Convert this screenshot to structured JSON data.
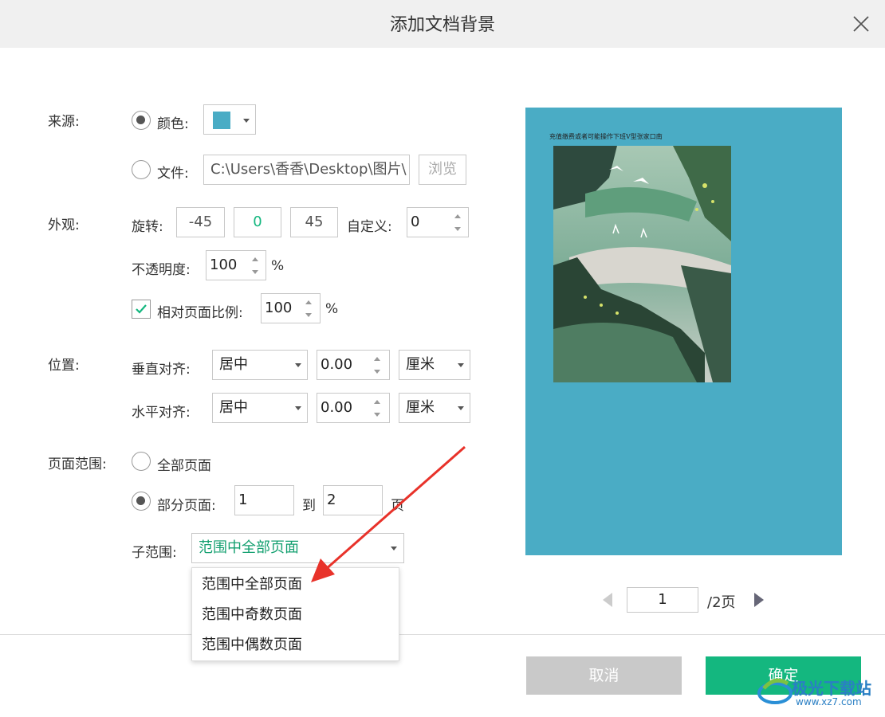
{
  "dialog": {
    "title": "添加文档背景"
  },
  "source": {
    "label": "来源:",
    "color_option": "颜色:",
    "color_value": "#4aacc5",
    "file_option": "文件:",
    "file_path": "C:\\Users\\香香\\Desktop\\图片\\",
    "browse": "浏览"
  },
  "appearance": {
    "label": "外观:",
    "rotate_label": "旋转:",
    "rotate_options": [
      "-45",
      "0",
      "45"
    ],
    "custom_label": "自定义:",
    "custom_value": "0",
    "opacity_label": "不透明度:",
    "opacity_value": "100",
    "percent": "%",
    "relative_label": "相对页面比例:",
    "relative_value": "100"
  },
  "position": {
    "label": "位置:",
    "vertical_label": "垂直对齐:",
    "vertical_align": "居中",
    "vertical_offset": "0.00",
    "vertical_unit": "厘米",
    "horizontal_label": "水平对齐:",
    "horizontal_align": "居中",
    "horizontal_offset": "0.00",
    "horizontal_unit": "厘米"
  },
  "page_range": {
    "label": "页面范围:",
    "all_pages": "全部页面",
    "partial_pages": "部分页面:",
    "from": "1",
    "to_label": "到",
    "to": "2",
    "page_suffix": "页",
    "sub_range_label": "子范围:",
    "sub_range_value": "范围中全部页面",
    "dropdown_options": [
      "范围中全部页面",
      "范围中奇数页面",
      "范围中偶数页面"
    ]
  },
  "preview": {
    "header_text": "充值缴费或者可能操作下班V型张家口南",
    "background_color": "#4aacc5",
    "page_input": "1",
    "page_total": "/2页"
  },
  "footer": {
    "cancel": "取消",
    "ok": "确定"
  },
  "watermark": {
    "brand": "极光下载站",
    "url": "www.xz7.com"
  }
}
